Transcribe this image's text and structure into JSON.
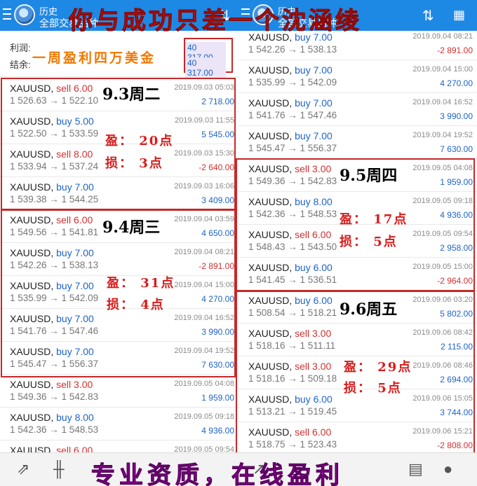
{
  "header": {
    "title": "历史",
    "subtitle": "全部交易品种",
    "banner": "你与成功只差一个沈涵绫"
  },
  "summary": {
    "profit_label": "利润:",
    "balance_label": "结余:",
    "profit_value": "40 317.00",
    "balance_value": "40 317.00",
    "weekly_note": "一周盈利四万美金"
  },
  "left_trades": [
    {
      "symbol": "XAUUSD,",
      "side": "sell",
      "lots": "6.00",
      "price": "1 526.63 → 1 522.10",
      "time": "2019.09.03 05:03",
      "pnl": "2 718.00",
      "pnl_sign": "pos"
    },
    {
      "symbol": "XAUUSD,",
      "side": "buy",
      "lots": "5.00",
      "price": "1 522.50 → 1 533.59",
      "time": "2019.09.03 11:55",
      "pnl": "5 545.00",
      "pnl_sign": "pos"
    },
    {
      "symbol": "XAUUSD,",
      "side": "sell",
      "lots": "8.00",
      "price": "1 533.94 → 1 537.24",
      "time": "2019.09.03 15:30",
      "pnl": "-2 640.00",
      "pnl_sign": "neg"
    },
    {
      "symbol": "XAUUSD,",
      "side": "buy",
      "lots": "7.00",
      "price": "1 539.38 → 1 544.25",
      "time": "2019.09.03 16:06",
      "pnl": "3 409.00",
      "pnl_sign": "pos"
    },
    {
      "symbol": "XAUUSD,",
      "side": "sell",
      "lots": "6.00",
      "price": "1 549.56 → 1 541.81",
      "time": "2019.09.04 03:59",
      "pnl": "4 650.00",
      "pnl_sign": "pos"
    },
    {
      "symbol": "XAUUSD,",
      "side": "buy",
      "lots": "7.00",
      "price": "1 542.26 → 1 538.13",
      "time": "2019.09.04 08:21",
      "pnl": "-2 891.00",
      "pnl_sign": "neg"
    },
    {
      "symbol": "XAUUSD,",
      "side": "buy",
      "lots": "7.00",
      "price": "1 535.99 → 1 542.09",
      "time": "2019.09.04 15:00",
      "pnl": "4 270.00",
      "pnl_sign": "pos"
    },
    {
      "symbol": "XAUUSD,",
      "side": "buy",
      "lots": "7.00",
      "price": "1 541.76 → 1 547.46",
      "time": "2019.09.04 16:52",
      "pnl": "3 990.00",
      "pnl_sign": "pos"
    },
    {
      "symbol": "XAUUSD,",
      "side": "buy",
      "lots": "7.00",
      "price": "1 545.47 → 1 556.37",
      "time": "2019.09.04 19:52",
      "pnl": "7 630.00",
      "pnl_sign": "pos"
    },
    {
      "symbol": "XAUUSD,",
      "side": "sell",
      "lots": "3.00",
      "price": "1 549.36 → 1 542.83",
      "time": "2019.09.05 04:08",
      "pnl": "1 959.00",
      "pnl_sign": "pos"
    },
    {
      "symbol": "XAUUSD,",
      "side": "buy",
      "lots": "8.00",
      "price": "1 542.36 → 1 548.53",
      "time": "2019.09.05 09:18",
      "pnl": "4 936.00",
      "pnl_sign": "pos"
    },
    {
      "symbol": "XAUUSD,",
      "side": "sell",
      "lots": "6.00",
      "price": "",
      "time": "2019.09.05 09:54",
      "pnl": "",
      "pnl_sign": "pos"
    }
  ],
  "right_trades": [
    {
      "symbol": "XAUUSD,",
      "side": "buy",
      "lots": "7.00",
      "price": "1 542.26 → 1 538.13",
      "time": "2019.09.04 08:21",
      "pnl": "-2 891.00",
      "pnl_sign": "neg"
    },
    {
      "symbol": "XAUUSD,",
      "side": "buy",
      "lots": "7.00",
      "price": "1 535.99 → 1 542.09",
      "time": "2019.09.04 15:00",
      "pnl": "4 270.00",
      "pnl_sign": "pos"
    },
    {
      "symbol": "XAUUSD,",
      "side": "buy",
      "lots": "7.00",
      "price": "1 541.76 → 1 547.46",
      "time": "2019.09.04 16:52",
      "pnl": "3 990.00",
      "pnl_sign": "pos"
    },
    {
      "symbol": "XAUUSD,",
      "side": "buy",
      "lots": "7.00",
      "price": "1 545.47 → 1 556.37",
      "time": "2019.09.04 19:52",
      "pnl": "7 630.00",
      "pnl_sign": "pos"
    },
    {
      "symbol": "XAUUSD,",
      "side": "sell",
      "lots": "3.00",
      "price": "1 549.36 → 1 542.83",
      "time": "2019.09.05 04:08",
      "pnl": "1 959.00",
      "pnl_sign": "pos"
    },
    {
      "symbol": "XAUUSD,",
      "side": "buy",
      "lots": "8.00",
      "price": "1 542.36 → 1 548.53",
      "time": "2019.09.05 09:18",
      "pnl": "4 936.00",
      "pnl_sign": "pos"
    },
    {
      "symbol": "XAUUSD,",
      "side": "sell",
      "lots": "6.00",
      "price": "1 548.43 → 1 543.50",
      "time": "2019.09.05 09:54",
      "pnl": "2 958.00",
      "pnl_sign": "pos"
    },
    {
      "symbol": "XAUUSD,",
      "side": "buy",
      "lots": "6.00",
      "price": "1 541.45 → 1 536.51",
      "time": "2019.09.05 15:00",
      "pnl": "-2 964.00",
      "pnl_sign": "neg"
    },
    {
      "symbol": "XAUUSD,",
      "side": "buy",
      "lots": "6.00",
      "price": "1 508.54 → 1 518.21",
      "time": "2019.09.06 03:20",
      "pnl": "5 802.00",
      "pnl_sign": "pos"
    },
    {
      "symbol": "XAUUSD,",
      "side": "sell",
      "lots": "3.00",
      "price": "1 518.16 → 1 511.11",
      "time": "2019.09.06 08:42",
      "pnl": "2 115.00",
      "pnl_sign": "pos"
    },
    {
      "symbol": "XAUUSD,",
      "side": "sell",
      "lots": "3.00",
      "price": "1 518.16 → 1 509.18",
      "time": "2019.09.06 08:46",
      "pnl": "2 694.00",
      "pnl_sign": "pos"
    },
    {
      "symbol": "XAUUSD,",
      "side": "buy",
      "lots": "6.00",
      "price": "1 513.21 → 1 519.45",
      "time": "2019.09.06 15:05",
      "pnl": "3 744.00",
      "pnl_sign": "pos"
    },
    {
      "symbol": "XAUUSD,",
      "side": "sell",
      "lots": "6.00",
      "price": "1 518.75 → 1 523.43",
      "time": "2019.09.06 15:21",
      "pnl": "-2 808.00",
      "pnl_sign": "neg"
    }
  ],
  "annotations": {
    "tue": "9.3周二",
    "tue_win": "盈： 20点",
    "tue_loss": "损： 3点",
    "wed": "9.4周三",
    "wed_win": "盈： 31点",
    "wed_loss": "损： 4点",
    "thu": "9.5周四",
    "thu_win": "盈： 17点",
    "thu_loss": "损： 5点",
    "fri": "9.6周五",
    "fri_win": "盈： 29点",
    "fri_loss": "损： 5点"
  },
  "footer": {
    "banner": "专业资质，在线盈利"
  },
  "icons": {
    "menu": "menu-icon",
    "sort": "sort-icon",
    "calendar": "calendar-icon",
    "quotes": "quotes-icon",
    "chart": "chart-icon",
    "trade": "trade-icon",
    "history": "history-icon",
    "messages": "messages-icon"
  }
}
